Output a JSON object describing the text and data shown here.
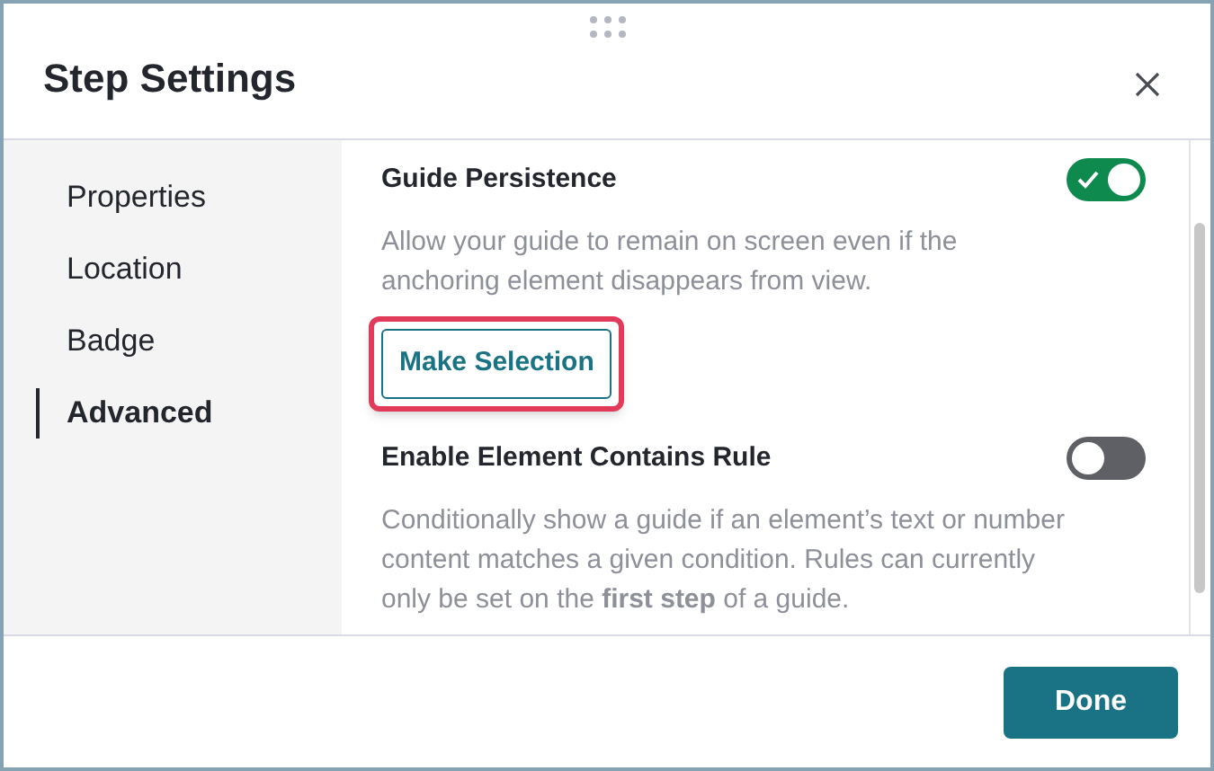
{
  "dialog": {
    "title": "Step Settings"
  },
  "nav": [
    {
      "label": "Properties",
      "selected": false
    },
    {
      "label": "Location",
      "selected": false
    },
    {
      "label": "Badge",
      "selected": false
    },
    {
      "label": "Advanced",
      "selected": true
    }
  ],
  "settings": [
    {
      "title": "Guide Persistence",
      "on": true,
      "description": "Allow your guide to remain on screen even if the anchoring element disappears from view.",
      "button": {
        "label": "Make Selection",
        "highlighted": true
      }
    },
    {
      "title": "Enable Element Contains Rule",
      "on": false,
      "description": "Conditionally show a guide if an element’s text or number content matches a given condition. Rules can currently only be set on the **first step** of a guide."
    }
  ],
  "footer": {
    "button": "Done"
  }
}
